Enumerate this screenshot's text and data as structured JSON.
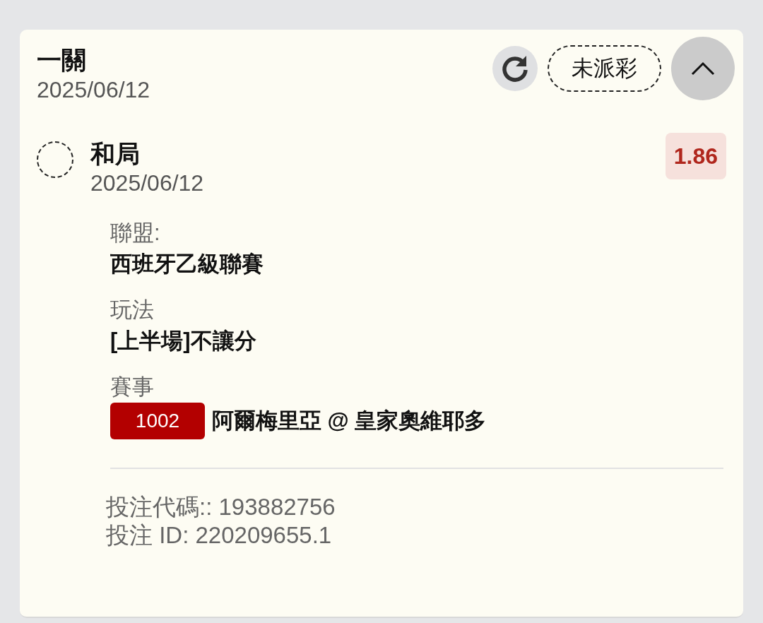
{
  "bet": {
    "title": "一關",
    "date": "2025/06/12",
    "status": "未派彩",
    "expanded": true,
    "selection": {
      "name": "和局",
      "date": "2025/06/12",
      "odds": "1.86",
      "selected": false
    },
    "details": [
      {
        "label": "聯盟:",
        "value": "西班牙乙級聯賽"
      },
      {
        "label": "玩法",
        "value": "[上半場]不讓分"
      },
      {
        "label": "賽事",
        "kind": "match",
        "number": "1002",
        "value": "阿爾梅里亞 @ 皇家奧維耶多"
      }
    ],
    "codes": [
      "投注代碼:: 193882756",
      "投注 ID: 220209655.1"
    ]
  }
}
